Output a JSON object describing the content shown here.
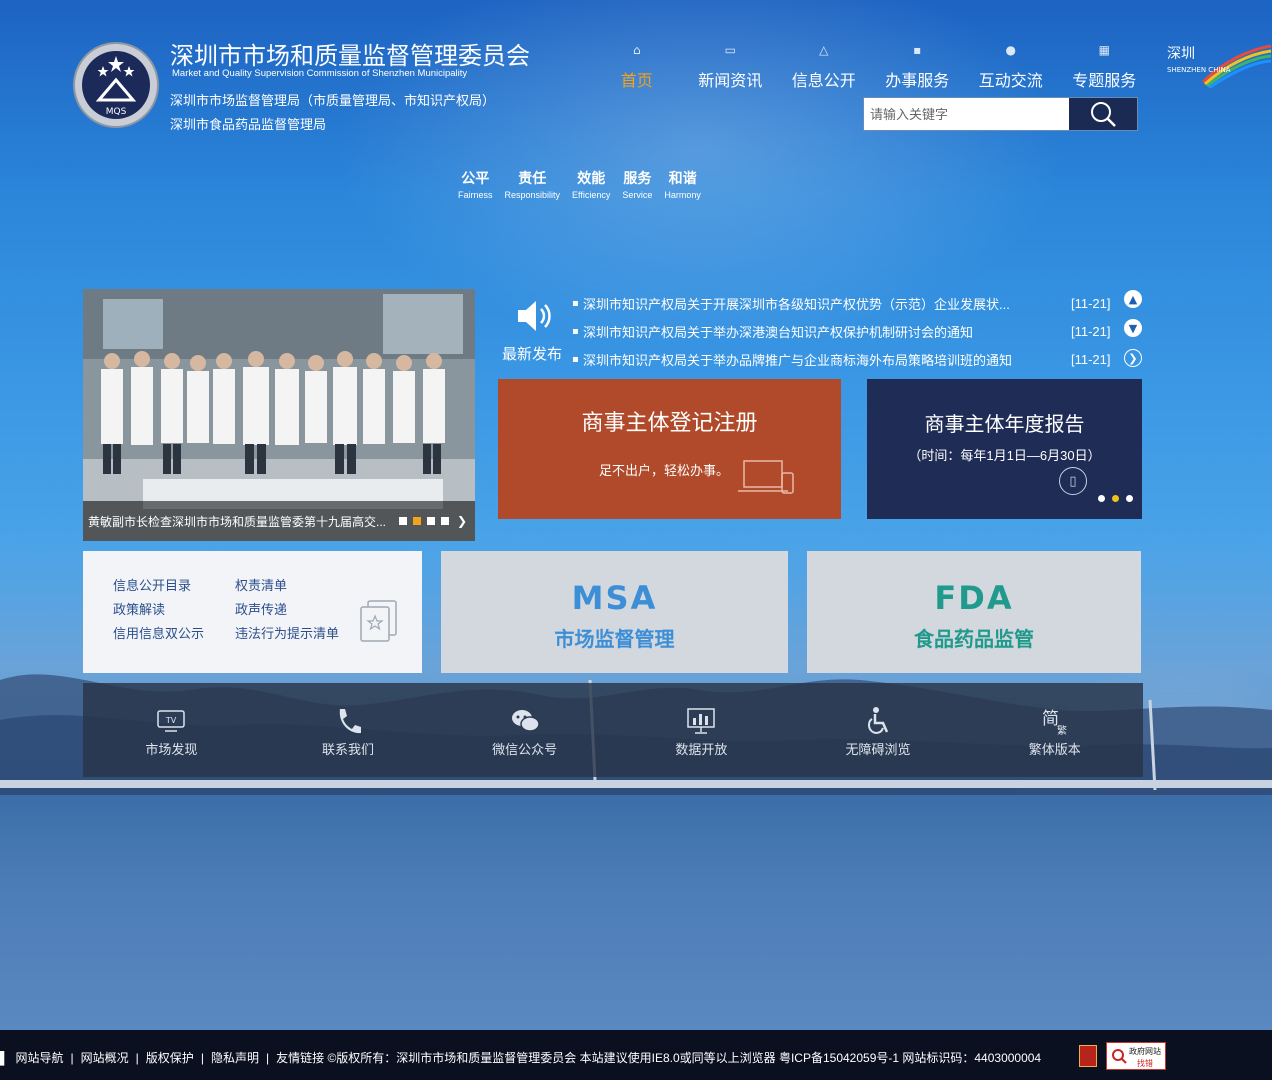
{
  "header": {
    "title_cn": "深圳市市场和质量监督管理委员会",
    "title_en": "Market and Quality Supervision Commission of Shenzhen Municipality",
    "subtitle_1": "深圳市市场监督管理局（市质量管理局、市知识产权局）",
    "subtitle_2": "深圳市食品药品监督管理局",
    "emblem_text": "MQS",
    "city_logo_text": "SHENZHEN CHINA"
  },
  "nav": {
    "items": [
      {
        "label": "首页",
        "icon": "home-icon",
        "active": true
      },
      {
        "label": "新闻资讯",
        "icon": "newspaper-icon"
      },
      {
        "label": "信息公开",
        "icon": "network-icon"
      },
      {
        "label": "办事服务",
        "icon": "briefcase-icon"
      },
      {
        "label": "互动交流",
        "icon": "chat-icon"
      },
      {
        "label": "专题服务",
        "icon": "grid-icon"
      }
    ]
  },
  "search": {
    "placeholder": "请输入关键字"
  },
  "values": [
    {
      "cn": "公平",
      "en": "Fairness"
    },
    {
      "cn": "责任",
      "en": "Responsibility"
    },
    {
      "cn": "效能",
      "en": "Efficiency"
    },
    {
      "cn": "服务",
      "en": "Service"
    },
    {
      "cn": "和谐",
      "en": "Harmony"
    }
  ],
  "carousel": {
    "caption": "黄敏副市长检查深圳市市场和质量监管委第十九届高交..."
  },
  "news": {
    "title": "最新发布",
    "items": [
      {
        "title": "深圳市知识产权局关于开展深圳市各级知识产权优势（示范）企业发展状...",
        "date": "[11-21]"
      },
      {
        "title": "深圳市知识产权局关于举办深港澳台知识产权保护机制研讨会的通知",
        "date": "[11-21]"
      },
      {
        "title": "深圳市知识产权局关于举办品牌推广与企业商标海外布局策略培训班的通知",
        "date": "[11-21]"
      }
    ]
  },
  "tiles": {
    "registration": {
      "title": "商事主体登记注册",
      "subtitle": "足不出户，轻松办事。"
    },
    "annual_report": {
      "title": "商事主体年度报告",
      "subtitle": "（时间：每年1月1日—6月30日）"
    },
    "info_links": [
      "信息公开目录",
      "权责清单",
      "政策解读",
      "政声传递",
      "信用信息双公示",
      "违法行为提示清单"
    ],
    "msa": {
      "logo": "MSA",
      "name": "市场监督管理"
    },
    "fda": {
      "logo": "FDA",
      "name": "食品药品监管"
    }
  },
  "quickbar": [
    {
      "label": "市场发现",
      "icon": "tv-icon"
    },
    {
      "label": "联系我们",
      "icon": "phone-icon"
    },
    {
      "label": "微信公众号",
      "icon": "wechat-icon"
    },
    {
      "label": "数据开放",
      "icon": "chart-icon"
    },
    {
      "label": "无障碍浏览",
      "icon": "accessibility-icon"
    },
    {
      "label": "繁体版本",
      "icon": "traditional-chinese-icon"
    }
  ],
  "footer": {
    "links": [
      "网站导航",
      "网站概况",
      "版权保护",
      "隐私声明",
      "友情链接"
    ],
    "copyright": "©版权所有：深圳市市场和质量监督管理委员会 本站建议使用IE8.0或同等以上浏览器 粤ICP备15042059号-1 网站标识码：4403000004",
    "badge_text_1": "政府网站",
    "badge_text_2": "找错"
  },
  "colors": {
    "nav_active": "#f2a21c",
    "registration_tile": "#b04a2a",
    "annual_tile": "#1f2c55",
    "msa_blue": "#3c8ed6",
    "fda_teal": "#1f9a8c",
    "footer_bg": "#0b1020"
  }
}
